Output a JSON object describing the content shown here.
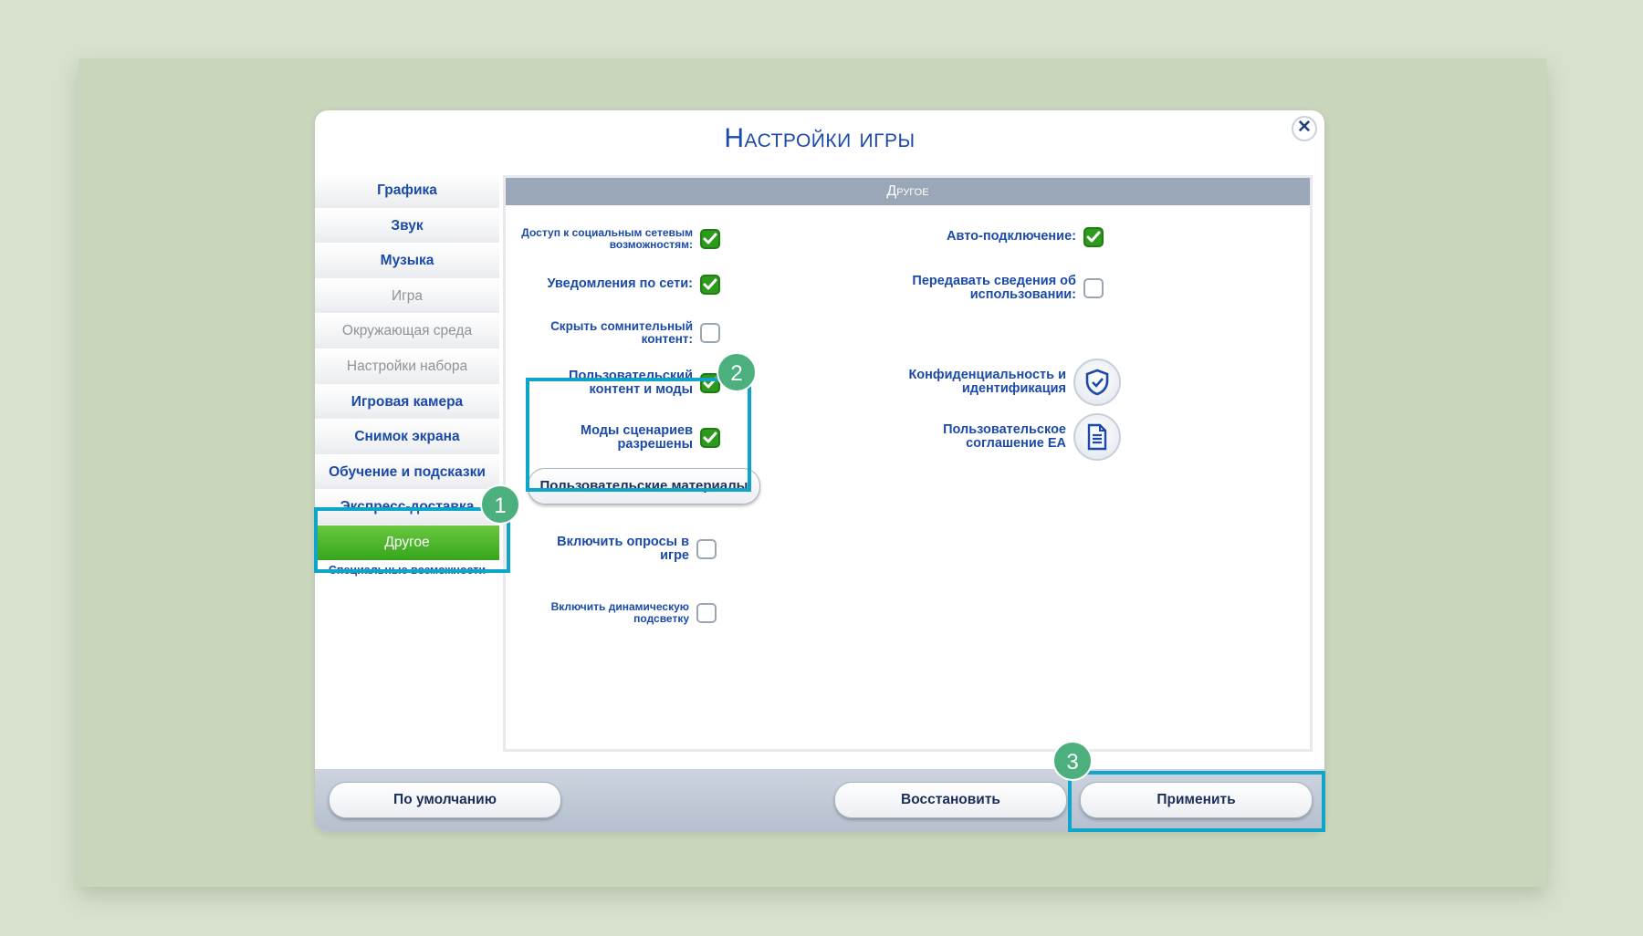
{
  "dialog": {
    "title": "Настройки игры",
    "close_icon": "close-icon"
  },
  "sidebar": {
    "items": [
      {
        "label": "Графика",
        "state": "normal"
      },
      {
        "label": "Звук",
        "state": "normal"
      },
      {
        "label": "Музыка",
        "state": "normal"
      },
      {
        "label": "Игра",
        "state": "disabled"
      },
      {
        "label": "Окружающая среда",
        "state": "disabled"
      },
      {
        "label": "Настройки набора",
        "state": "disabled"
      },
      {
        "label": "Игровая камера",
        "state": "normal"
      },
      {
        "label": "Снимок экрана",
        "state": "normal"
      },
      {
        "label": "Обучение и подсказки",
        "state": "normal"
      },
      {
        "label": "Экспресс-доставка",
        "state": "normal"
      },
      {
        "label": "Другое",
        "state": "active"
      },
      {
        "label": "Специальные возможности",
        "state": "normal"
      }
    ]
  },
  "section": {
    "title": "Другое"
  },
  "options": {
    "social": {
      "label": "Доступ к социальным сетевым возможностям:",
      "checked": true
    },
    "notifications": {
      "label": "Уведомления по сети:",
      "checked": true
    },
    "hide_content": {
      "label": "Скрыть сомнительный контент:",
      "checked": false
    },
    "custom_content": {
      "label": "Пользовательский контент и моды",
      "checked": true
    },
    "script_mods": {
      "label": "Моды сценариев разрешены",
      "checked": true
    },
    "surveys": {
      "label": "Включить опросы в игре",
      "checked": false
    },
    "dynamic_lighting": {
      "label": "Включить динамическую подсветку",
      "checked": false
    },
    "auto_connect": {
      "label": "Авто-подключение:",
      "checked": true
    },
    "usage_data": {
      "label": "Передавать сведения об использовании:",
      "checked": false
    }
  },
  "links": {
    "privacy": {
      "label": "Конфиденциальность и идентификация",
      "icon": "shield-check-icon"
    },
    "user_agreement": {
      "label": "Пользовательское соглашение EA",
      "icon": "document-icon"
    }
  },
  "buttons": {
    "custom_materials": "Пользовательские материалы",
    "defaults": "По умолчанию",
    "restore": "Восстановить",
    "apply": "Применить"
  },
  "annotations": {
    "badge_1": "1",
    "badge_2": "2",
    "badge_3": "3"
  },
  "colors": {
    "accent_blue": "#1b4aa8",
    "highlight": "#0ea5c8",
    "badge": "#4caf7e",
    "active_green": "#36a51d"
  }
}
